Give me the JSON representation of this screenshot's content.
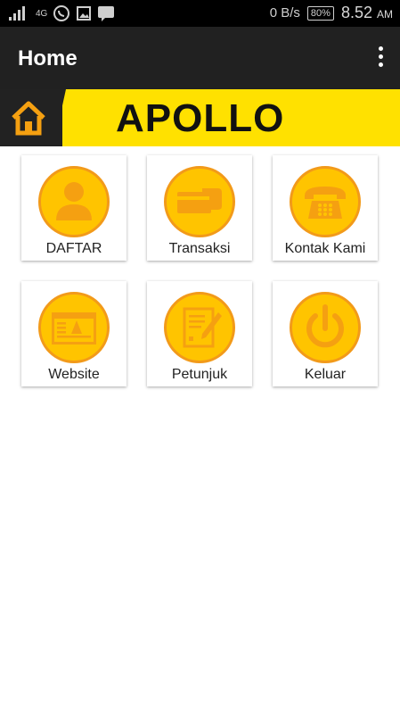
{
  "status": {
    "network": "4G",
    "speed": "0 B/s",
    "battery": "80%",
    "time": "8.52",
    "ampm": "AM"
  },
  "appbar": {
    "title": "Home"
  },
  "banner": {
    "logo": "APOLLO"
  },
  "menu": [
    {
      "label": "DAFTAR",
      "icon": "person-icon"
    },
    {
      "label": "Transaksi",
      "icon": "card-payment-icon"
    },
    {
      "label": "Kontak Kami",
      "icon": "telephone-icon"
    },
    {
      "label": "Website",
      "icon": "browser-icon"
    },
    {
      "label": "Petunjuk",
      "icon": "document-pen-icon"
    },
    {
      "label": "Keluar",
      "icon": "power-icon"
    }
  ],
  "colors": {
    "accent": "#ffc400",
    "accent_border": "#f29a1a",
    "icon": "#f5a011",
    "banner_yellow": "#ffe100",
    "app_bar": "#212121"
  }
}
